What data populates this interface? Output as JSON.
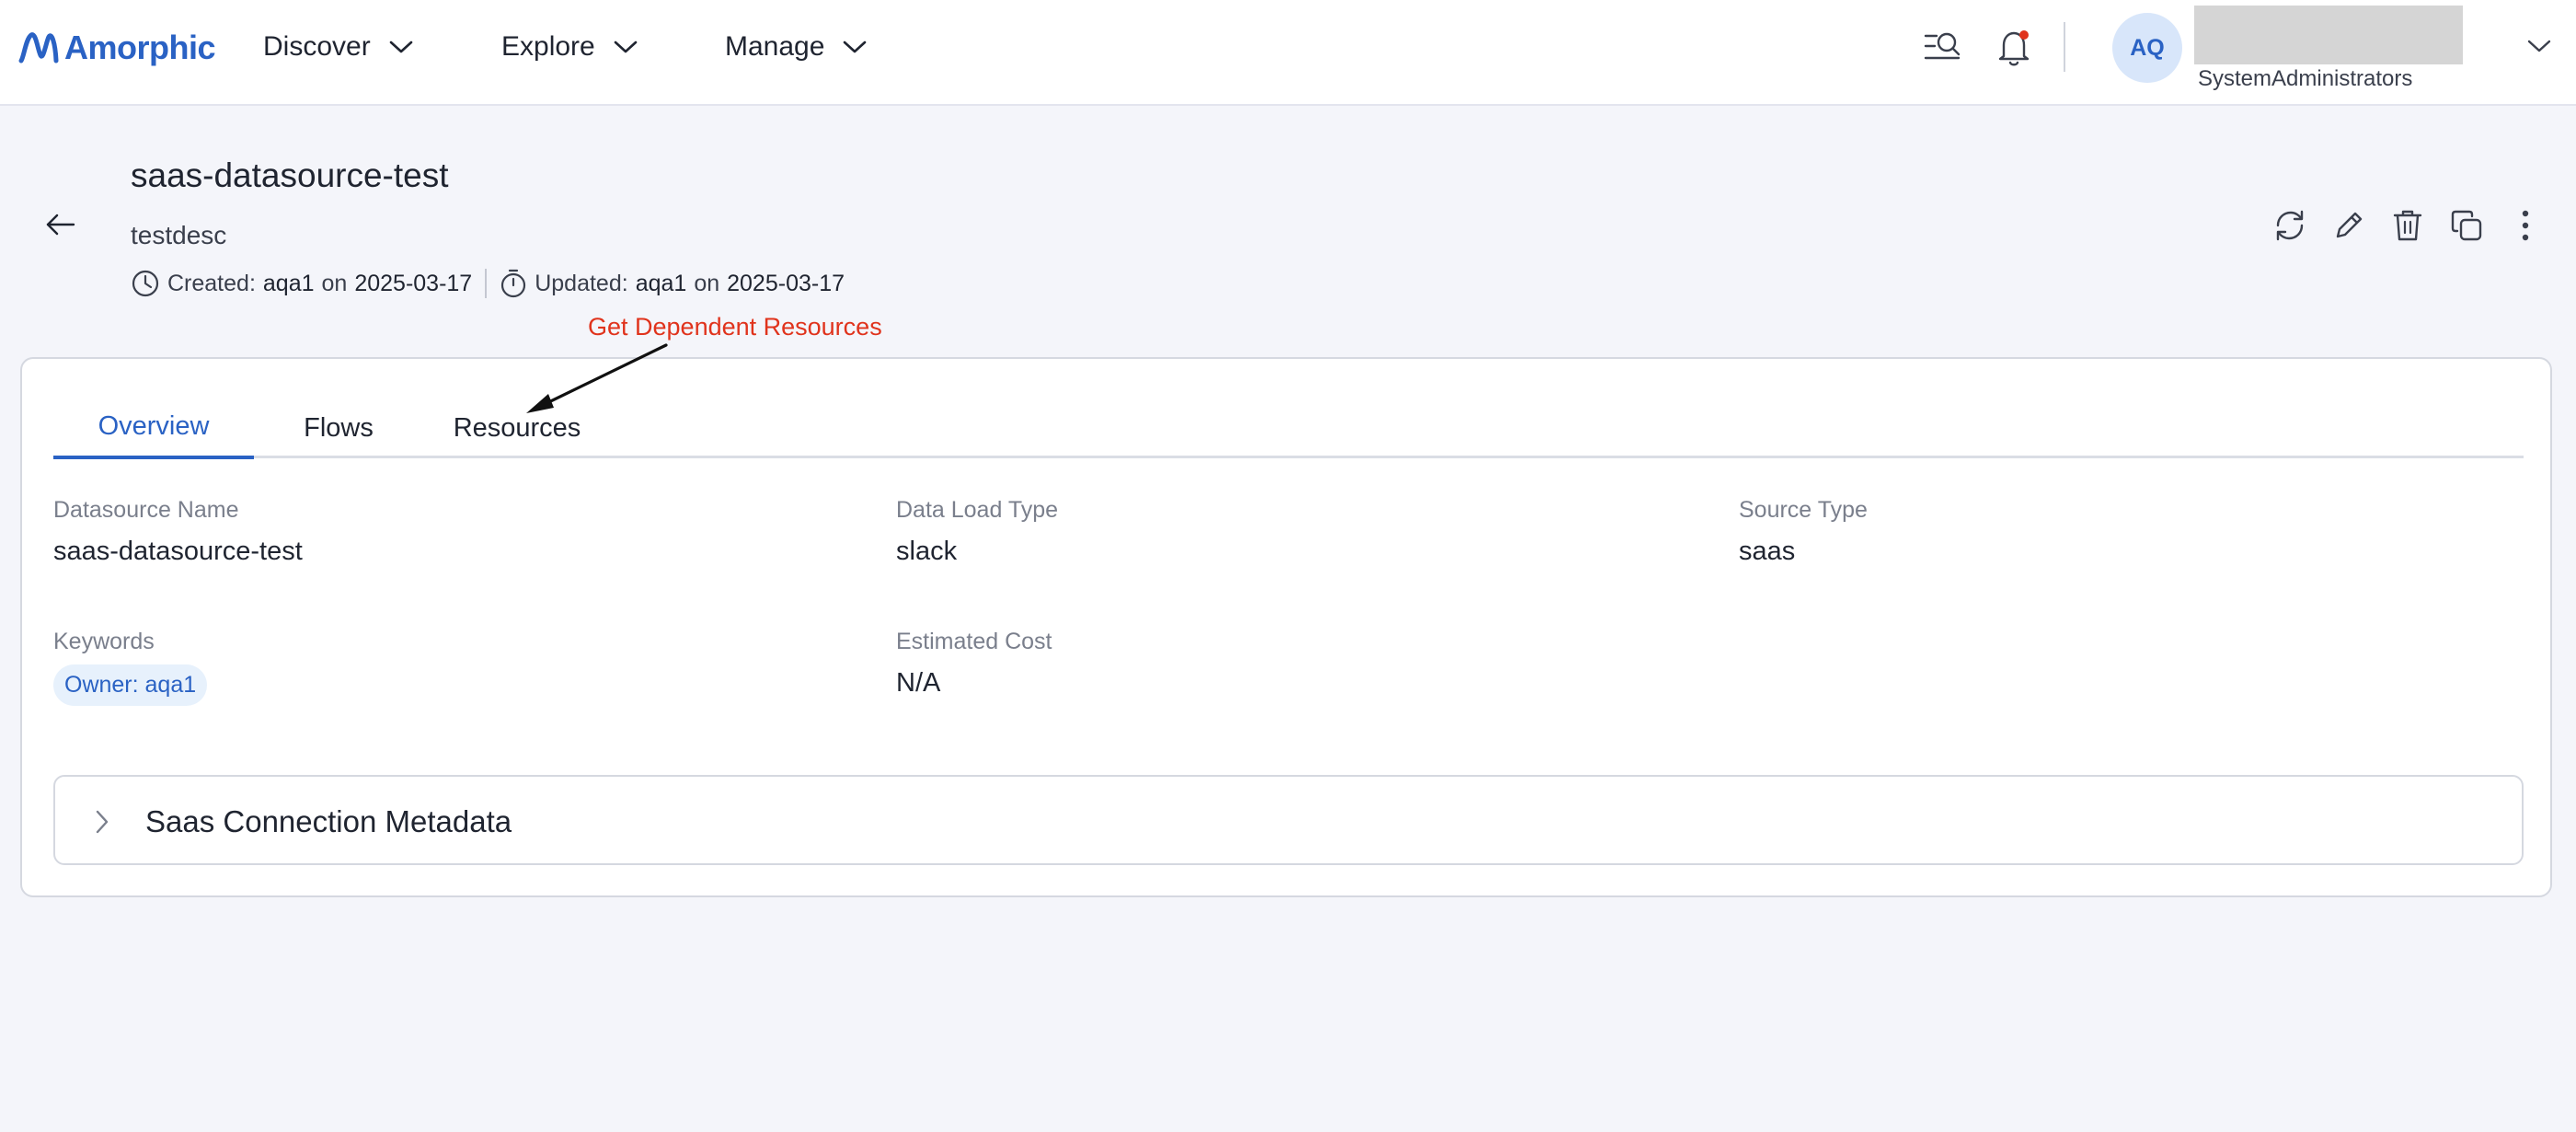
{
  "header": {
    "logo_text": "Amorphic",
    "nav": [
      {
        "label": "Discover"
      },
      {
        "label": "Explore"
      },
      {
        "label": "Manage"
      }
    ],
    "user": {
      "initials": "AQ",
      "role": "SystemAdministrators"
    },
    "icons": [
      "search-list-icon",
      "bell-icon",
      "chevron-down-icon"
    ]
  },
  "page": {
    "title": "saas-datasource-test",
    "description": "testdesc",
    "created_label": "Created:",
    "created_by": "aqa1",
    "created_on_label": "on",
    "created_date": "2025-03-17",
    "updated_label": "Updated:",
    "updated_by": "aqa1",
    "updated_on_label": "on",
    "updated_date": "2025-03-17",
    "actions": [
      "refresh-icon",
      "edit-icon",
      "delete-icon",
      "copy-icon",
      "more-vertical-icon"
    ]
  },
  "annotation": {
    "text": "Get Dependent Resources"
  },
  "tabs": [
    {
      "label": "Overview",
      "active": true
    },
    {
      "label": "Flows",
      "active": false
    },
    {
      "label": "Resources",
      "active": false
    }
  ],
  "overview": {
    "datasource_name": {
      "label": "Datasource Name",
      "value": "saas-datasource-test"
    },
    "data_load_type": {
      "label": "Data Load Type",
      "value": "slack"
    },
    "source_type": {
      "label": "Source Type",
      "value": "saas"
    },
    "keywords": {
      "label": "Keywords",
      "chips": [
        "Owner: aqa1"
      ]
    },
    "estimated_cost": {
      "label": "Estimated Cost",
      "value": "N/A"
    }
  },
  "accordion": {
    "title": "Saas Connection Metadata",
    "expanded": false
  },
  "colors": {
    "accent": "#2a62c4",
    "annotation": "#e0331c",
    "notification_dot": "#e0331c",
    "page_bg": "#f4f5fa"
  }
}
